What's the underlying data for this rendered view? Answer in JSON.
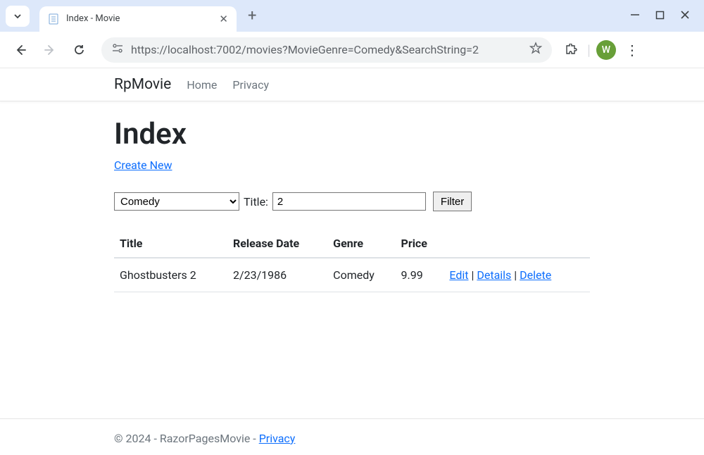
{
  "browser": {
    "tab_title": "Index - Movie",
    "url": "https://localhost:7002/movies?MovieGenre=Comedy&SearchString=2",
    "profile_letter": "W"
  },
  "nav": {
    "brand": "RpMovie",
    "home": "Home",
    "privacy": "Privacy"
  },
  "page": {
    "heading": "Index",
    "create_new": "Create New",
    "genre_selected": "Comedy",
    "title_label": "Title:",
    "title_value": "2",
    "filter_label": "Filter"
  },
  "table": {
    "headers": {
      "title": "Title",
      "release_date": "Release Date",
      "genre": "Genre",
      "price": "Price"
    },
    "rows": [
      {
        "title": "Ghostbusters 2",
        "release_date": "2/23/1986",
        "genre": "Comedy",
        "price": "9.99",
        "edit": "Edit",
        "details": "Details",
        "delete": "Delete"
      }
    ]
  },
  "footer": {
    "text": "© 2024 - RazorPagesMovie - ",
    "privacy": "Privacy"
  }
}
